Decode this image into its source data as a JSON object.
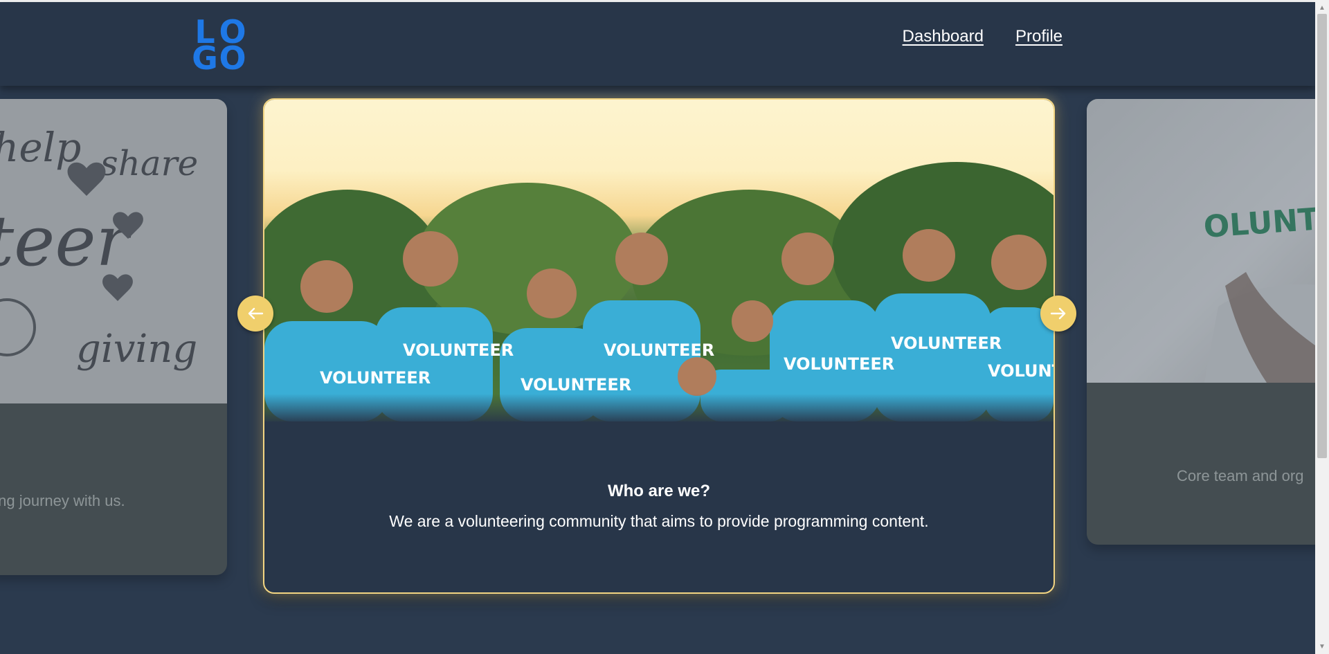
{
  "header": {
    "logo_letters": [
      "L",
      "O",
      "G",
      "O"
    ],
    "nav": [
      {
        "label": "Dashboard"
      },
      {
        "label": "Profile"
      }
    ]
  },
  "carousel": {
    "left_card": {
      "text": "ning journey with us.",
      "image_words": [
        "help",
        "share",
        "teer",
        "giving"
      ]
    },
    "main_card": {
      "title": "Who are we?",
      "description": "We are a volunteering community that aims to provide programming content.",
      "image_shirt_text": "VOLUNTEER"
    },
    "right_card": {
      "text": "Core team and org",
      "image_shirt_text": "OLUNTEE"
    },
    "prev_icon": "arrow-left-icon",
    "next_icon": "arrow-right-icon"
  },
  "colors": {
    "background": "#2b3a4e",
    "header": "#283649",
    "accent": "#f0cf6c",
    "logo": "#1e78e6",
    "shirt": "#3aaed6"
  }
}
